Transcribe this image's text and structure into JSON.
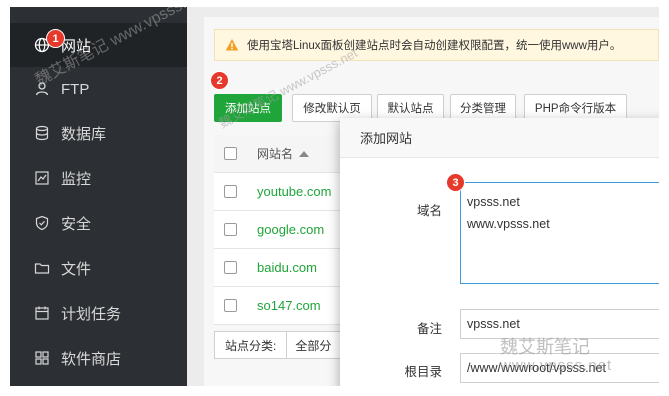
{
  "sidebar": {
    "items": [
      {
        "label": "网站",
        "icon": "globe-icon",
        "active": true
      },
      {
        "label": "FTP",
        "icon": "user-icon",
        "active": false
      },
      {
        "label": "数据库",
        "icon": "database-icon",
        "active": false
      },
      {
        "label": "监控",
        "icon": "monitor-icon",
        "active": false
      },
      {
        "label": "安全",
        "icon": "shield-icon",
        "active": false
      },
      {
        "label": "文件",
        "icon": "folder-icon",
        "active": false
      },
      {
        "label": "计划任务",
        "icon": "calendar-icon",
        "active": false
      },
      {
        "label": "软件商店",
        "icon": "grid-icon",
        "active": false
      }
    ]
  },
  "notice": {
    "text": "使用宝塔Linux面板创建站点时会自动创建权限配置，统一使用www用户。",
    "icon": "warning-icon"
  },
  "toolbar": {
    "add_site": "添加站点",
    "modify_default_page": "修改默认页",
    "default_site": "默认站点",
    "category_manage": "分类管理",
    "php_cli_version": "PHP命令行版本"
  },
  "table": {
    "header": "网站名",
    "rows": [
      "youtube.com",
      "google.com",
      "baidu.com",
      "so147.com"
    ]
  },
  "category": {
    "label": "站点分类:",
    "value": "全部分"
  },
  "modal": {
    "title": "添加网站",
    "domain_label": "域名",
    "domain_lines": [
      "vpsss.net",
      "www.vpsss.net"
    ],
    "remark_label": "备注",
    "remark_value": "vpsss.net",
    "root_label": "根目录",
    "root_value": "/www/wwwroot/vpsss.net"
  },
  "markers": [
    "1",
    "2",
    "3"
  ],
  "watermark": {
    "diag_text": "魏艾斯笔记 www.vpsss.net",
    "corner_cn": "魏艾斯笔记",
    "corner_url": "www.vpsss.net"
  },
  "colors": {
    "accent_green": "#20a53a",
    "sidebar_bg": "#2c2f33",
    "marker_red": "#e6392b",
    "focus_blue": "#3f9be0"
  }
}
